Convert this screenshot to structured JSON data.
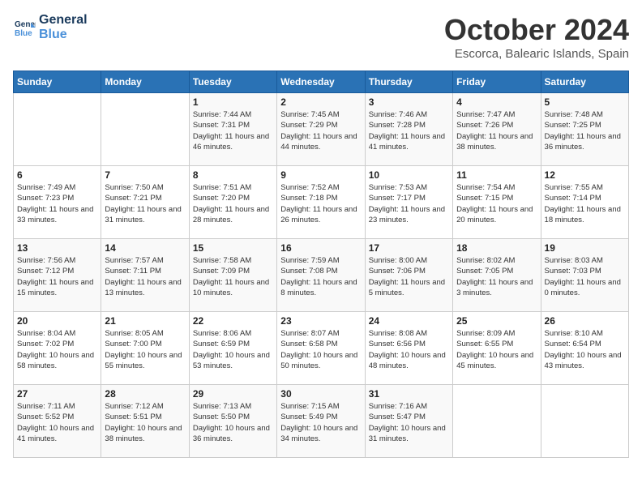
{
  "header": {
    "logo_line1": "General",
    "logo_line2": "Blue",
    "month": "October 2024",
    "location": "Escorca, Balearic Islands, Spain"
  },
  "weekdays": [
    "Sunday",
    "Monday",
    "Tuesday",
    "Wednesday",
    "Thursday",
    "Friday",
    "Saturday"
  ],
  "weeks": [
    [
      {
        "day": "",
        "info": ""
      },
      {
        "day": "",
        "info": ""
      },
      {
        "day": "1",
        "info": "Sunrise: 7:44 AM\nSunset: 7:31 PM\nDaylight: 11 hours and 46 minutes."
      },
      {
        "day": "2",
        "info": "Sunrise: 7:45 AM\nSunset: 7:29 PM\nDaylight: 11 hours and 44 minutes."
      },
      {
        "day": "3",
        "info": "Sunrise: 7:46 AM\nSunset: 7:28 PM\nDaylight: 11 hours and 41 minutes."
      },
      {
        "day": "4",
        "info": "Sunrise: 7:47 AM\nSunset: 7:26 PM\nDaylight: 11 hours and 38 minutes."
      },
      {
        "day": "5",
        "info": "Sunrise: 7:48 AM\nSunset: 7:25 PM\nDaylight: 11 hours and 36 minutes."
      }
    ],
    [
      {
        "day": "6",
        "info": "Sunrise: 7:49 AM\nSunset: 7:23 PM\nDaylight: 11 hours and 33 minutes."
      },
      {
        "day": "7",
        "info": "Sunrise: 7:50 AM\nSunset: 7:21 PM\nDaylight: 11 hours and 31 minutes."
      },
      {
        "day": "8",
        "info": "Sunrise: 7:51 AM\nSunset: 7:20 PM\nDaylight: 11 hours and 28 minutes."
      },
      {
        "day": "9",
        "info": "Sunrise: 7:52 AM\nSunset: 7:18 PM\nDaylight: 11 hours and 26 minutes."
      },
      {
        "day": "10",
        "info": "Sunrise: 7:53 AM\nSunset: 7:17 PM\nDaylight: 11 hours and 23 minutes."
      },
      {
        "day": "11",
        "info": "Sunrise: 7:54 AM\nSunset: 7:15 PM\nDaylight: 11 hours and 20 minutes."
      },
      {
        "day": "12",
        "info": "Sunrise: 7:55 AM\nSunset: 7:14 PM\nDaylight: 11 hours and 18 minutes."
      }
    ],
    [
      {
        "day": "13",
        "info": "Sunrise: 7:56 AM\nSunset: 7:12 PM\nDaylight: 11 hours and 15 minutes."
      },
      {
        "day": "14",
        "info": "Sunrise: 7:57 AM\nSunset: 7:11 PM\nDaylight: 11 hours and 13 minutes."
      },
      {
        "day": "15",
        "info": "Sunrise: 7:58 AM\nSunset: 7:09 PM\nDaylight: 11 hours and 10 minutes."
      },
      {
        "day": "16",
        "info": "Sunrise: 7:59 AM\nSunset: 7:08 PM\nDaylight: 11 hours and 8 minutes."
      },
      {
        "day": "17",
        "info": "Sunrise: 8:00 AM\nSunset: 7:06 PM\nDaylight: 11 hours and 5 minutes."
      },
      {
        "day": "18",
        "info": "Sunrise: 8:02 AM\nSunset: 7:05 PM\nDaylight: 11 hours and 3 minutes."
      },
      {
        "day": "19",
        "info": "Sunrise: 8:03 AM\nSunset: 7:03 PM\nDaylight: 11 hours and 0 minutes."
      }
    ],
    [
      {
        "day": "20",
        "info": "Sunrise: 8:04 AM\nSunset: 7:02 PM\nDaylight: 10 hours and 58 minutes."
      },
      {
        "day": "21",
        "info": "Sunrise: 8:05 AM\nSunset: 7:00 PM\nDaylight: 10 hours and 55 minutes."
      },
      {
        "day": "22",
        "info": "Sunrise: 8:06 AM\nSunset: 6:59 PM\nDaylight: 10 hours and 53 minutes."
      },
      {
        "day": "23",
        "info": "Sunrise: 8:07 AM\nSunset: 6:58 PM\nDaylight: 10 hours and 50 minutes."
      },
      {
        "day": "24",
        "info": "Sunrise: 8:08 AM\nSunset: 6:56 PM\nDaylight: 10 hours and 48 minutes."
      },
      {
        "day": "25",
        "info": "Sunrise: 8:09 AM\nSunset: 6:55 PM\nDaylight: 10 hours and 45 minutes."
      },
      {
        "day": "26",
        "info": "Sunrise: 8:10 AM\nSunset: 6:54 PM\nDaylight: 10 hours and 43 minutes."
      }
    ],
    [
      {
        "day": "27",
        "info": "Sunrise: 7:11 AM\nSunset: 5:52 PM\nDaylight: 10 hours and 41 minutes."
      },
      {
        "day": "28",
        "info": "Sunrise: 7:12 AM\nSunset: 5:51 PM\nDaylight: 10 hours and 38 minutes."
      },
      {
        "day": "29",
        "info": "Sunrise: 7:13 AM\nSunset: 5:50 PM\nDaylight: 10 hours and 36 minutes."
      },
      {
        "day": "30",
        "info": "Sunrise: 7:15 AM\nSunset: 5:49 PM\nDaylight: 10 hours and 34 minutes."
      },
      {
        "day": "31",
        "info": "Sunrise: 7:16 AM\nSunset: 5:47 PM\nDaylight: 10 hours and 31 minutes."
      },
      {
        "day": "",
        "info": ""
      },
      {
        "day": "",
        "info": ""
      }
    ]
  ]
}
